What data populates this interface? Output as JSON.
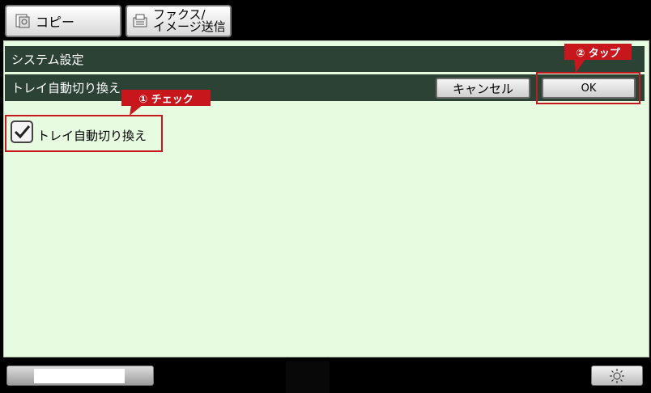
{
  "tabs": {
    "copy": {
      "label": "コピー",
      "icon": "copy-icon"
    },
    "fax": {
      "line1": "ファクス/",
      "line2": "イメージ送信",
      "icon": "fax-icon"
    }
  },
  "header": {
    "title": "システム設定",
    "subtitle": "トレイ自動切り換え"
  },
  "buttons": {
    "cancel": "キャンセル",
    "ok": "OK"
  },
  "checkbox": {
    "label": "トレイ自動切り換え",
    "checked": true
  },
  "annotations": {
    "step1": "① チェック",
    "step2": "② タップ"
  },
  "footer": {
    "brightness_icon": "sun-icon"
  },
  "colors": {
    "accent_red": "#c8161d",
    "bar": "#2b4235",
    "panel": "#e6fbe0"
  }
}
